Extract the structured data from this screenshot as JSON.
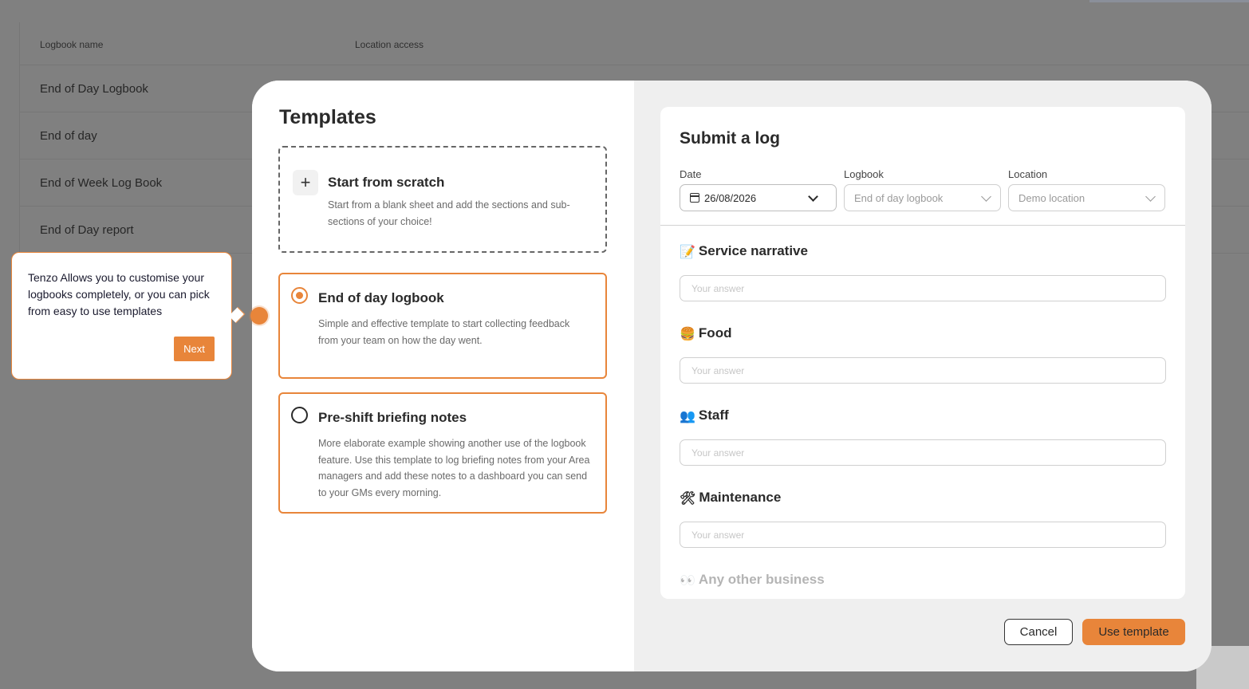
{
  "background_table": {
    "columns": [
      "Logbook name",
      "Location access"
    ],
    "rows": [
      "End of Day Logbook",
      "End of day",
      "End of Week Log Book",
      "End of Day report"
    ]
  },
  "templates": {
    "title": "Templates",
    "scratch": {
      "title": "Start from scratch",
      "desc": "Start from a blank sheet and add the sections and sub-sections of your choice!"
    },
    "options": [
      {
        "title": "End of day logbook",
        "desc": "Simple and effective template to start collecting feedback from your team on how the day went.",
        "selected": true
      },
      {
        "title": "Pre-shift briefing notes",
        "desc": "More elaborate example showing another use of the logbook feature. Use this template to log briefing notes from your Area managers and add these notes to a dashboard you can send to your GMs every morning.",
        "selected": false
      }
    ]
  },
  "preview": {
    "title": "Submit a log",
    "fields": {
      "date_label": "Date",
      "date_value": "26/08/2026",
      "logbook_label": "Logbook",
      "logbook_value": "End of day logbook",
      "location_label": "Location",
      "location_value": "Demo location"
    },
    "answer_placeholder": "Your answer",
    "sections": [
      {
        "emoji": "📝",
        "title": "Service narrative"
      },
      {
        "emoji": "🍔",
        "title": "Food"
      },
      {
        "emoji": "👥",
        "title": "Staff"
      },
      {
        "emoji": "🛠",
        "title": "Maintenance"
      },
      {
        "emoji": "👀",
        "title": "Any other business"
      }
    ]
  },
  "buttons": {
    "cancel": "Cancel",
    "use_template": "Use template"
  },
  "tooltip": {
    "text": "Tenzo Allows you to customise your logbooks completely, or you can pick from easy to use templates",
    "next": "Next"
  },
  "colors": {
    "accent": "#e8853a",
    "overlay": "#808080"
  }
}
